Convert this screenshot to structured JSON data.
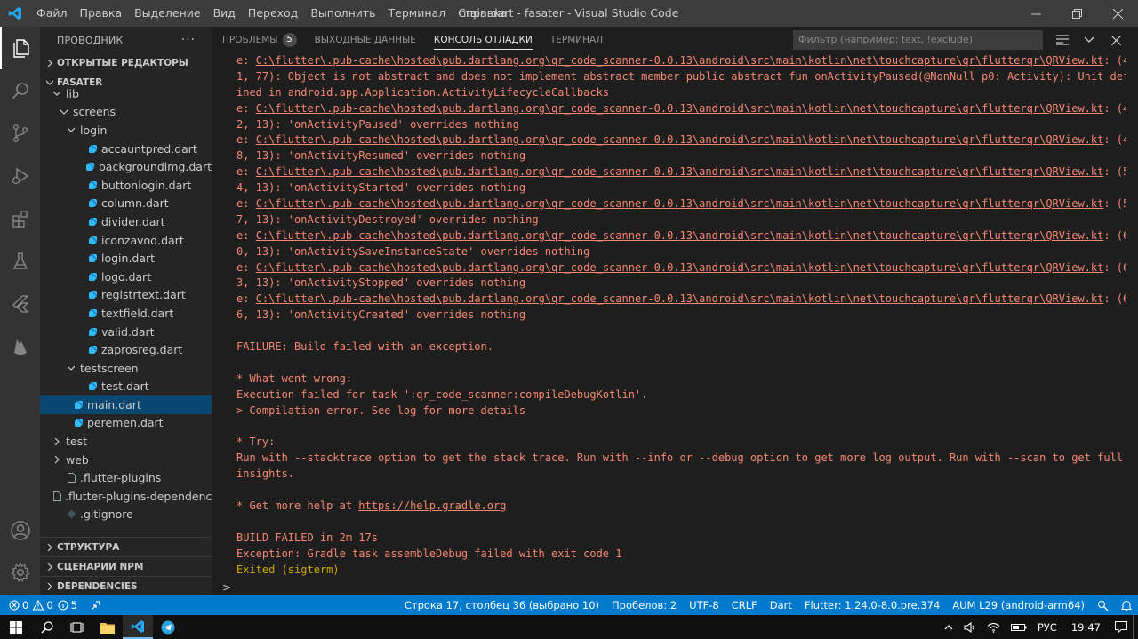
{
  "titlebar": {
    "menu": [
      "Файл",
      "Правка",
      "Выделение",
      "Вид",
      "Переход",
      "Выполнить",
      "Терминал",
      "Справка"
    ],
    "title": "main.dart - fasater - Visual Studio Code"
  },
  "sidebar": {
    "title": "ПРОВОДНИК",
    "more": "···",
    "open_editors": "ОТКРЫТЫЕ РЕДАКТОРЫ",
    "project": "FASATER",
    "tree": [
      {
        "label": "lib",
        "indent": 1,
        "kind": "folder-open"
      },
      {
        "label": "screens",
        "indent": 2,
        "kind": "folder-open"
      },
      {
        "label": "login",
        "indent": 3,
        "kind": "folder-open"
      },
      {
        "label": "accauntpred.dart",
        "indent": 4,
        "kind": "dart"
      },
      {
        "label": "backgroundimg.dart",
        "indent": 4,
        "kind": "dart"
      },
      {
        "label": "buttonlogin.dart",
        "indent": 4,
        "kind": "dart"
      },
      {
        "label": "column.dart",
        "indent": 4,
        "kind": "dart"
      },
      {
        "label": "divider.dart",
        "indent": 4,
        "kind": "dart"
      },
      {
        "label": "iconzavod.dart",
        "indent": 4,
        "kind": "dart"
      },
      {
        "label": "login.dart",
        "indent": 4,
        "kind": "dart"
      },
      {
        "label": "logo.dart",
        "indent": 4,
        "kind": "dart"
      },
      {
        "label": "registrtext.dart",
        "indent": 4,
        "kind": "dart"
      },
      {
        "label": "textfield.dart",
        "indent": 4,
        "kind": "dart"
      },
      {
        "label": "valid.dart",
        "indent": 4,
        "kind": "dart"
      },
      {
        "label": "zaprosreg.dart",
        "indent": 4,
        "kind": "dart"
      },
      {
        "label": "testscreen",
        "indent": 3,
        "kind": "folder-open"
      },
      {
        "label": "test.dart",
        "indent": 4,
        "kind": "dart"
      },
      {
        "label": "main.dart",
        "indent": 2,
        "kind": "dart",
        "selected": true
      },
      {
        "label": "peremen.dart",
        "indent": 2,
        "kind": "dart"
      },
      {
        "label": "test",
        "indent": 1,
        "kind": "folder"
      },
      {
        "label": "web",
        "indent": 1,
        "kind": "folder"
      },
      {
        "label": ".flutter-plugins",
        "indent": 1,
        "kind": "file"
      },
      {
        "label": ".flutter-plugins-dependencies",
        "indent": 1,
        "kind": "file"
      },
      {
        "label": ".gitignore",
        "indent": 1,
        "kind": "git"
      }
    ],
    "sections_bottom": [
      "СТРУКТУРА",
      "СЦЕНАРИИ NPM",
      "DEPENDENCIES"
    ]
  },
  "panel": {
    "tabs": [
      {
        "label": "ПРОБЛЕМЫ",
        "badge": "5"
      },
      {
        "label": "ВЫХОДНЫЕ ДАННЫЕ"
      },
      {
        "label": "КОНСОЛЬ ОТЛАДКИ",
        "active": true
      },
      {
        "label": "ТЕРМИНАЛ"
      }
    ],
    "filter_placeholder": "Фильтр (например: text, !exclude)",
    "prompt": ">"
  },
  "console": [
    {
      "parts": [
        {
          "t": "e: "
        },
        {
          "t": "C:\\flutter\\.pub-cache\\hosted\\pub.dartlang.org\\qr_code_scanner-0.0.13\\android\\src\\main\\kotlin\\net\\touchcapture\\qr\\flutterqr\\QRView.kt",
          "link": true
        },
        {
          "t": ": (4"
        }
      ],
      "cls": "err"
    },
    {
      "parts": [
        {
          "t": "1, 77): Object is not abstract and does not implement abstract member public abstract fun onActivityPaused(@NonNull p0: Activity): Unit def"
        }
      ],
      "cls": "err"
    },
    {
      "parts": [
        {
          "t": "ined in android.app.Application.ActivityLifecycleCallbacks"
        }
      ],
      "cls": "err"
    },
    {
      "parts": [
        {
          "t": "e: "
        },
        {
          "t": "C:\\flutter\\.pub-cache\\hosted\\pub.dartlang.org\\qr_code_scanner-0.0.13\\android\\src\\main\\kotlin\\net\\touchcapture\\qr\\flutterqr\\QRView.kt",
          "link": true
        },
        {
          "t": ": (4"
        }
      ],
      "cls": "err"
    },
    {
      "parts": [
        {
          "t": "2, 13): 'onActivityPaused' overrides nothing"
        }
      ],
      "cls": "err"
    },
    {
      "parts": [
        {
          "t": "e: "
        },
        {
          "t": "C:\\flutter\\.pub-cache\\hosted\\pub.dartlang.org\\qr_code_scanner-0.0.13\\android\\src\\main\\kotlin\\net\\touchcapture\\qr\\flutterqr\\QRView.kt",
          "link": true
        },
        {
          "t": ": (4"
        }
      ],
      "cls": "err"
    },
    {
      "parts": [
        {
          "t": "8, 13): 'onActivityResumed' overrides nothing"
        }
      ],
      "cls": "err"
    },
    {
      "parts": [
        {
          "t": "e: "
        },
        {
          "t": "C:\\flutter\\.pub-cache\\hosted\\pub.dartlang.org\\qr_code_scanner-0.0.13\\android\\src\\main\\kotlin\\net\\touchcapture\\qr\\flutterqr\\QRView.kt",
          "link": true
        },
        {
          "t": ": (5"
        }
      ],
      "cls": "err"
    },
    {
      "parts": [
        {
          "t": "4, 13): 'onActivityStarted' overrides nothing"
        }
      ],
      "cls": "err"
    },
    {
      "parts": [
        {
          "t": "e: "
        },
        {
          "t": "C:\\flutter\\.pub-cache\\hosted\\pub.dartlang.org\\qr_code_scanner-0.0.13\\android\\src\\main\\kotlin\\net\\touchcapture\\qr\\flutterqr\\QRView.kt",
          "link": true
        },
        {
          "t": ": (5"
        }
      ],
      "cls": "err"
    },
    {
      "parts": [
        {
          "t": "7, 13): 'onActivityDestroyed' overrides nothing"
        }
      ],
      "cls": "err"
    },
    {
      "parts": [
        {
          "t": "e: "
        },
        {
          "t": "C:\\flutter\\.pub-cache\\hosted\\pub.dartlang.org\\qr_code_scanner-0.0.13\\android\\src\\main\\kotlin\\net\\touchcapture\\qr\\flutterqr\\QRView.kt",
          "link": true
        },
        {
          "t": ": (6"
        }
      ],
      "cls": "err"
    },
    {
      "parts": [
        {
          "t": "0, 13): 'onActivitySaveInstanceState' overrides nothing"
        }
      ],
      "cls": "err"
    },
    {
      "parts": [
        {
          "t": "e: "
        },
        {
          "t": "C:\\flutter\\.pub-cache\\hosted\\pub.dartlang.org\\qr_code_scanner-0.0.13\\android\\src\\main\\kotlin\\net\\touchcapture\\qr\\flutterqr\\QRView.kt",
          "link": true
        },
        {
          "t": ": (6"
        }
      ],
      "cls": "err"
    },
    {
      "parts": [
        {
          "t": "3, 13): 'onActivityStopped' overrides nothing"
        }
      ],
      "cls": "err"
    },
    {
      "parts": [
        {
          "t": "e: "
        },
        {
          "t": "C:\\flutter\\.pub-cache\\hosted\\pub.dartlang.org\\qr_code_scanner-0.0.13\\android\\src\\main\\kotlin\\net\\touchcapture\\qr\\flutterqr\\QRView.kt",
          "link": true
        },
        {
          "t": ": (6"
        }
      ],
      "cls": "err"
    },
    {
      "parts": [
        {
          "t": "6, 13): 'onActivityCreated' overrides nothing"
        }
      ],
      "cls": "err"
    },
    {
      "parts": [
        {
          "t": ""
        }
      ],
      "cls": "err"
    },
    {
      "parts": [
        {
          "t": "FAILURE: Build failed with an exception."
        }
      ],
      "cls": "err"
    },
    {
      "parts": [
        {
          "t": ""
        }
      ],
      "cls": "err"
    },
    {
      "parts": [
        {
          "t": "* What went wrong:"
        }
      ],
      "cls": "err"
    },
    {
      "parts": [
        {
          "t": "Execution failed for task ':qr_code_scanner:compileDebugKotlin'."
        }
      ],
      "cls": "err"
    },
    {
      "parts": [
        {
          "t": "> Compilation error. See log for more details"
        }
      ],
      "cls": "err"
    },
    {
      "parts": [
        {
          "t": ""
        }
      ],
      "cls": "err"
    },
    {
      "parts": [
        {
          "t": "* Try:"
        }
      ],
      "cls": "err"
    },
    {
      "parts": [
        {
          "t": "Run with --stacktrace option to get the stack trace. Run with --info or --debug option to get more log output. Run with --scan to get full"
        }
      ],
      "cls": "err"
    },
    {
      "parts": [
        {
          "t": "insights."
        }
      ],
      "cls": "err"
    },
    {
      "parts": [
        {
          "t": ""
        }
      ],
      "cls": "err"
    },
    {
      "parts": [
        {
          "t": "* Get more help at "
        },
        {
          "t": "https://help.gradle.org",
          "link": true
        }
      ],
      "cls": "err"
    },
    {
      "parts": [
        {
          "t": ""
        }
      ],
      "cls": "err"
    },
    {
      "parts": [
        {
          "t": "BUILD FAILED in 2m 17s"
        }
      ],
      "cls": "err"
    },
    {
      "parts": [
        {
          "t": "Exception: Gradle task assembleDebug failed with exit code 1"
        }
      ],
      "cls": "err"
    },
    {
      "parts": [
        {
          "t": "Exited (sigterm)"
        }
      ],
      "cls": "warn"
    }
  ],
  "statusbar": {
    "errors": "0",
    "warnings": "0",
    "infos": "5",
    "cursor": "Строка 17, столбец 36 (выбрано 10)",
    "spaces": "Пробелов: 2",
    "encoding": "UTF-8",
    "eol": "CRLF",
    "language": "Dart",
    "flutter": "Flutter: 1.24.0-8.0.pre.374",
    "device": "AUM L29 (android-arm64)"
  },
  "taskbar": {
    "lang": "РУС",
    "time": "19:47"
  },
  "colors": {
    "accent": "#007acc",
    "error_text": "#f48771",
    "warning_text": "#cca700",
    "selection": "#094771"
  }
}
